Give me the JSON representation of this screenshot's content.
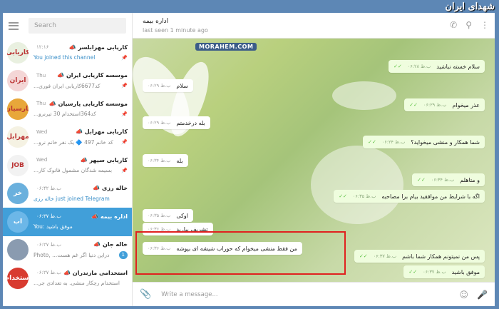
{
  "logo": "شهدای ایران",
  "sidebar": {
    "search_placeholder": "Search",
    "chats": [
      {
        "name": "کاریابی مهرابلسر",
        "time": "۱۲:۱۶",
        "preview": "You joined this channel",
        "avatar_text": "کاریابی",
        "avatar_color": "#e9f0e0",
        "pinned": true
      },
      {
        "name": "موسسه کاریابی ایران",
        "time": "Thu",
        "preview": "...کد6677کاریابی ایران فوری",
        "avatar_text": "ایران",
        "avatar_color": "#f4d6d6",
        "pinned": true
      },
      {
        "name": "موسسه کاریابی پارسیان",
        "time": "Thu",
        "preview": "...کد364استخدام 30 تیرنرو",
        "avatar_text": "پارسیان",
        "avatar_color": "#e8a73a",
        "pinned": true
      },
      {
        "name": "کاریابی مهرابل",
        "time": "Wed",
        "preview": "...کد خانم 497 🔷 یک نفر خانم نرو",
        "avatar_text": "مهرابل",
        "avatar_color": "#f5f2e3",
        "pinned": true
      },
      {
        "name": "کاریابی سپهر",
        "time": "Wed",
        "preview": "...بسیمه شدگان مشمول فانوک کار",
        "avatar_text": "JOB",
        "avatar_color": "#f2f2f2",
        "pinned": true
      },
      {
        "name": "خاله رزی",
        "time": "ب.ظ ۰۶:۴۲",
        "preview": "خاله رزی just joined Telegram",
        "avatar_text": "خر",
        "avatar_color": "#6ab0dd",
        "pinned": false
      },
      {
        "name": "اداره بیمه",
        "time": "ب.ظ ۰۶:۳۷",
        "preview": "You: موفق باشید",
        "avatar_text": "اب",
        "avatar_color": "#6cb7e8",
        "pinned": false,
        "active": true
      },
      {
        "name": "خاله جان",
        "time": "ب.ظ ۰۶:۲۷",
        "preview": "Photo, ...دراین دنیا اگر غم هست",
        "avatar_text": "",
        "avatar_color": "#8a9bb0",
        "pinned": false,
        "badge": "1"
      },
      {
        "name": "استخدامی مازندران",
        "time": "ب.ظ ۰۶:۲۷",
        "preview": "...استخدام رچکار منشی. به تعدادی جر",
        "avatar_text": "استخدام",
        "avatar_color": "#d83b30",
        "pinned": false
      }
    ]
  },
  "header": {
    "peer_name": "اداره بیمه",
    "status": "last seen 1 minute ago"
  },
  "watermark": "MORAHEM.COM",
  "messages": [
    {
      "text": "سلام خسته نباشید",
      "time": "ب.ظ ۰۶:۲۸",
      "dir": "out"
    },
    {
      "text": "سلام",
      "time": "ب.ظ ۰۶:۲۹",
      "dir": "in"
    },
    {
      "text": "عذر میخوام",
      "time": "ب.ظ ۰۶:۲۹",
      "dir": "out"
    },
    {
      "text": "بله درخدمتم",
      "time": "ب.ظ ۰۶:۲۹",
      "dir": "in"
    },
    {
      "text": "شما همکار و منشی میخواید؟",
      "time": "ب.ظ ۰۶:۲۴",
      "dir": "out"
    },
    {
      "text": "بله",
      "time": "ب.ظ ۰۶:۳۴",
      "dir": "in"
    },
    {
      "text": "و متاهلم",
      "time": "ب.ظ ۰۶:۳۴",
      "dir": "out"
    },
    {
      "text": "اگه با شرایط من موافقید بیام برا مصاحبه",
      "time": "ب.ظ ۰۶:۳۵",
      "dir": "out"
    },
    {
      "text": "اوکی",
      "time": "ب.ظ ۰۶:۳۵",
      "dir": "in"
    },
    {
      "text": "تشریف بیارید",
      "time": "ب.ظ ۰۶:۳۶",
      "dir": "in"
    },
    {
      "text": "من فقط منشی میخوام که حوراب شیشه ای بپوشه",
      "time": "ب.ظ ۰۶:۳۶",
      "dir": "in"
    },
    {
      "text": "پس من نمیتونم همکار شما باشم",
      "time": "ب.ظ ۰۶:۳۷",
      "dir": "out"
    },
    {
      "text": "موفق باشید",
      "time": "ب.ظ ۰۶:۳۷",
      "dir": "out"
    }
  ],
  "composer": {
    "placeholder": "Write a message..."
  }
}
